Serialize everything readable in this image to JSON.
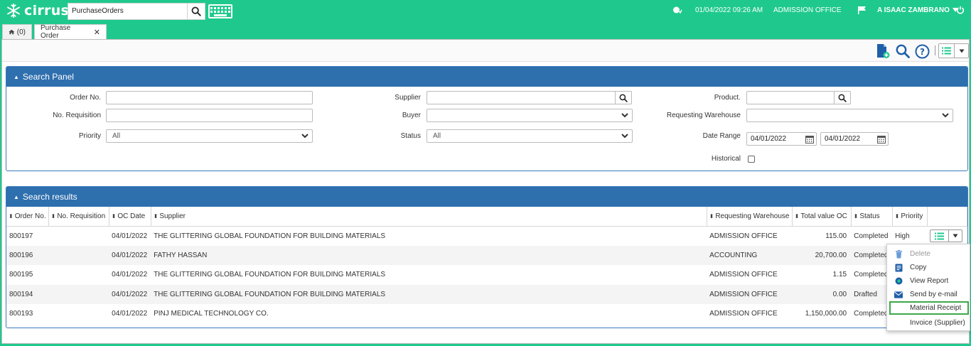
{
  "app": {
    "logo": "cirrus"
  },
  "header": {
    "search_value": "PurchaseOrders",
    "datetime": "01/04/2022 09:26 AM",
    "location": "ADMISSION OFFICE",
    "user": "A ISAAC ZAMBRANO"
  },
  "tabs": [
    {
      "label": "(0)"
    },
    {
      "label": "Purchase Order"
    }
  ],
  "search_panel": {
    "title": "Search Panel",
    "order_no_label": "Order No.",
    "order_no_value": "",
    "requisition_label": "No. Requisition",
    "requisition_value": "",
    "priority_label": "Priority",
    "priority_value": "All",
    "supplier_label": "Supplier",
    "supplier_value": "",
    "buyer_label": "Buyer",
    "buyer_value": "",
    "status_label": "Status",
    "status_value": "All",
    "product_label": "Product.",
    "product_value": "",
    "warehouse_label": "Requesting Warehouse",
    "warehouse_value": "",
    "date_range_label": "Date Range",
    "date_from": "04/01/2022",
    "date_to": "04/01/2022",
    "historical_label": "Historical",
    "historical_checked": false
  },
  "results": {
    "title": "Search results",
    "columns": [
      "Order No.",
      "No. Requisition",
      "OC Date",
      "Supplier",
      "Requesting Warehouse",
      "Total value OC",
      "Status",
      "Priority"
    ],
    "rows": [
      {
        "order_no": "800197",
        "requisition": "",
        "date": "04/01/2022",
        "supplier": "THE GLITTERING GLOBAL FOUNDATION FOR BUILDING MATERIALS",
        "warehouse": "ADMISSION OFFICE",
        "total": "115.00",
        "status": "Completed",
        "priority": "High"
      },
      {
        "order_no": "800196",
        "requisition": "",
        "date": "04/01/2022",
        "supplier": "FATHY HASSAN",
        "warehouse": "ACCOUNTING",
        "total": "20,700.00",
        "status": "Completed",
        "priority": ""
      },
      {
        "order_no": "800195",
        "requisition": "",
        "date": "04/01/2022",
        "supplier": "THE GLITTERING GLOBAL FOUNDATION FOR BUILDING MATERIALS",
        "warehouse": "ADMISSION OFFICE",
        "total": "1.15",
        "status": "Completed",
        "priority": ""
      },
      {
        "order_no": "800194",
        "requisition": "",
        "date": "04/01/2022",
        "supplier": "THE GLITTERING GLOBAL FOUNDATION FOR BUILDING MATERIALS",
        "warehouse": "ADMISSION OFFICE",
        "total": "0.00",
        "status": "Drafted",
        "priority": ""
      },
      {
        "order_no": "800193",
        "requisition": "",
        "date": "04/01/2022",
        "supplier": "PINJ MEDICAL TECHNOLOGY CO.",
        "warehouse": "ADMISSION OFFICE",
        "total": "1,150,000.00",
        "status": "Completed",
        "priority": ""
      }
    ]
  },
  "row_menu": {
    "items": [
      {
        "label": "Delete",
        "icon": "trash-icon",
        "disabled": true
      },
      {
        "label": "Copy",
        "icon": "document-icon",
        "disabled": false
      },
      {
        "label": "View Report",
        "icon": "report-icon",
        "disabled": false
      },
      {
        "label": "Send by e-mail",
        "icon": "envelope-icon",
        "disabled": false
      },
      {
        "label": "Material Receipt",
        "icon": "",
        "disabled": false,
        "highlighted": true
      },
      {
        "label": "Invoice (Supplier)",
        "icon": "",
        "disabled": false
      }
    ]
  },
  "colors": {
    "brand": "#1fc98e",
    "panel_header": "#2e6fae",
    "toolbar_icon": "#1f5fa8",
    "highlight_border": "#3aa84a"
  }
}
